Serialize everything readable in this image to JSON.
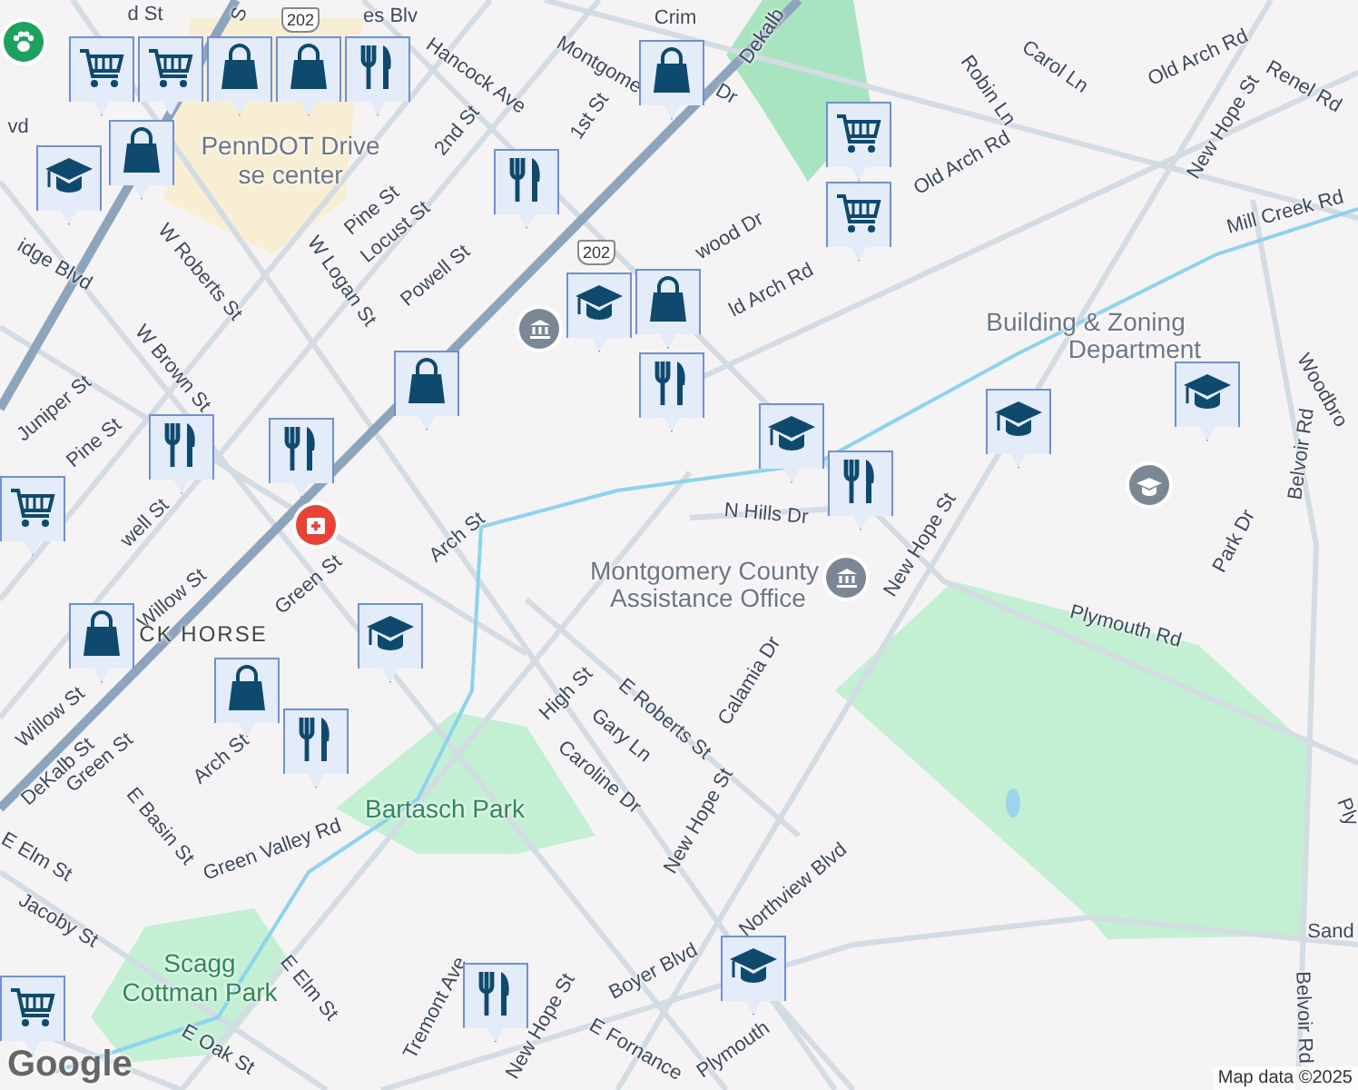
{
  "streets": [
    {
      "name": "d St"
    },
    {
      "name": "S"
    },
    {
      "name": "es Blv"
    },
    {
      "name": "Hancock Ave"
    },
    {
      "name": "Montgome"
    },
    {
      "name": "Crim"
    },
    {
      "name": "Dr"
    },
    {
      "name": "1st St"
    },
    {
      "name": "2nd St"
    },
    {
      "name": "Dekalb"
    },
    {
      "name": "vd"
    },
    {
      "name": "idge Blvd"
    },
    {
      "name": "W Roberts St"
    },
    {
      "name": "Pine St"
    },
    {
      "name": "W Logan St"
    },
    {
      "name": "Locust St"
    },
    {
      "name": "Powell St"
    },
    {
      "name": "W Brown St"
    },
    {
      "name": "Juniper St"
    },
    {
      "name": "Pine St"
    },
    {
      "name": "well St"
    },
    {
      "name": "Willow St"
    },
    {
      "name": "Green St"
    },
    {
      "name": "Arch St"
    },
    {
      "name": "wood Dr"
    },
    {
      "name": "ld Arch Rd"
    },
    {
      "name": "Old Arch Rd"
    },
    {
      "name": "Old Arch Rd"
    },
    {
      "name": "Robin Ln"
    },
    {
      "name": "Carol Ln"
    },
    {
      "name": "New Hope St"
    },
    {
      "name": "Renel Rd"
    },
    {
      "name": "Mill Creek Rd"
    },
    {
      "name": "Woodbro"
    },
    {
      "name": "Belvoir Rd"
    },
    {
      "name": "N Hills Dr"
    },
    {
      "name": "New Hope St"
    },
    {
      "name": "Park Dr"
    },
    {
      "name": "Plymouth Rd"
    },
    {
      "name": "Calamia Dr"
    },
    {
      "name": "Willow St"
    },
    {
      "name": "DeKalb St"
    },
    {
      "name": "Green St"
    },
    {
      "name": "E Basin St"
    },
    {
      "name": "Arch St"
    },
    {
      "name": "Green Valley Rd"
    },
    {
      "name": "E Elm St"
    },
    {
      "name": "Jacoby St"
    },
    {
      "name": "High St"
    },
    {
      "name": "Gary Ln"
    },
    {
      "name": "E Roberts St"
    },
    {
      "name": "Caroline Dr"
    },
    {
      "name": "New Hope St"
    },
    {
      "name": "Northview Blvd"
    },
    {
      "name": "E Elm St"
    },
    {
      "name": "E Oak St"
    },
    {
      "name": "Tremont Ave"
    },
    {
      "name": "New Hope St"
    },
    {
      "name": "E Fornance"
    },
    {
      "name": "Boyer Blvd"
    },
    {
      "name": "Plymouth"
    },
    {
      "name": "Ply"
    },
    {
      "name": "Sand"
    },
    {
      "name": "Belvoir Rd"
    }
  ],
  "places": [
    {
      "name": "PennDOT Drive",
      "kind": "place"
    },
    {
      "name": "se center",
      "kind": "place"
    },
    {
      "name": "Building & Zoning",
      "kind": "place"
    },
    {
      "name": "Department",
      "kind": "place"
    },
    {
      "name": "Montgomery County",
      "kind": "place"
    },
    {
      "name": "Assistance Office",
      "kind": "place"
    },
    {
      "name": "CK HORSE",
      "kind": "district"
    },
    {
      "name": "Bartasch Park",
      "kind": "park"
    },
    {
      "name": "Scagg",
      "kind": "park"
    },
    {
      "name": "Cottman Park",
      "kind": "park"
    }
  ],
  "shields": [
    {
      "label": "202"
    },
    {
      "label": "202"
    }
  ],
  "pins": [
    {
      "kind": "pet"
    },
    {
      "kind": "hospital"
    },
    {
      "kind": "government"
    },
    {
      "kind": "government"
    },
    {
      "kind": "school"
    }
  ],
  "markers": [
    {
      "kind": "grocery"
    },
    {
      "kind": "grocery"
    },
    {
      "kind": "shopping"
    },
    {
      "kind": "shopping"
    },
    {
      "kind": "restaurant"
    },
    {
      "kind": "shopping"
    },
    {
      "kind": "school"
    },
    {
      "kind": "shopping"
    },
    {
      "kind": "grocery"
    },
    {
      "kind": "school"
    },
    {
      "kind": "shopping"
    },
    {
      "kind": "restaurant"
    },
    {
      "kind": "shopping"
    },
    {
      "kind": "restaurant"
    },
    {
      "kind": "restaurant"
    },
    {
      "kind": "school"
    },
    {
      "kind": "restaurant"
    },
    {
      "kind": "school"
    },
    {
      "kind": "school"
    },
    {
      "kind": "grocery"
    },
    {
      "kind": "school"
    },
    {
      "kind": "shopping"
    },
    {
      "kind": "restaurant"
    },
    {
      "kind": "shopping"
    },
    {
      "kind": "restaurant"
    },
    {
      "kind": "school"
    },
    {
      "kind": "grocery"
    },
    {
      "kind": "restaurant"
    },
    {
      "kind": "grocery"
    }
  ],
  "logo": "Google",
  "attribution": "Map data ©2025"
}
